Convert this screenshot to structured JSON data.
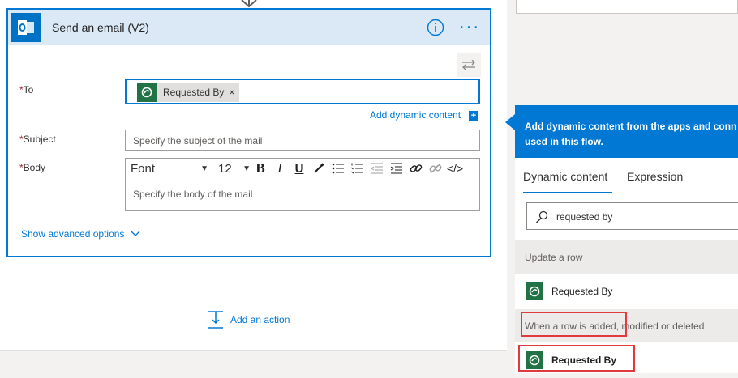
{
  "card": {
    "title": "Send an email (V2)",
    "to_label": "To",
    "required_marker": "*",
    "to_token": "Requested By",
    "to_token_remove": "×",
    "add_dynamic_content": "Add dynamic content",
    "add_dynamic_plus": "+",
    "subject_label": "Subject",
    "subject_placeholder": "Specify the subject of the mail",
    "body_label": "Body",
    "font_value": "Font",
    "font_size_value": "12",
    "toolbar": {
      "bold": "B",
      "italic": "I",
      "underline": "U",
      "code": "</>"
    },
    "body_placeholder": "Specify the body of the mail",
    "show_advanced": "Show advanced options"
  },
  "add_action": "Add an action",
  "panel": {
    "header": "Add dynamic content from the apps and connectors used in this flow.",
    "header_line1": "Add dynamic content from the apps and conn",
    "header_line2": "used in this flow.",
    "tabs": [
      {
        "label": "Dynamic content",
        "active": true
      },
      {
        "label": "Expression",
        "active": false
      }
    ],
    "search_value": "requested by",
    "groups": [
      {
        "label": "Update a row",
        "items": [
          "Requested By"
        ]
      },
      {
        "label": "When a row is added, modified or deleted",
        "items": [
          "Requested By"
        ]
      }
    ]
  },
  "colors": {
    "accent": "#0078d4",
    "dataverse_green": "#217346",
    "highlight_red": "#e0393e",
    "required_red": "#a4262c"
  },
  "icons": [
    "outlook-icon",
    "info-icon",
    "more-icon",
    "swap-icon",
    "dataverse-icon",
    "chevron-down-icon",
    "add-action-icon",
    "search-icon"
  ]
}
